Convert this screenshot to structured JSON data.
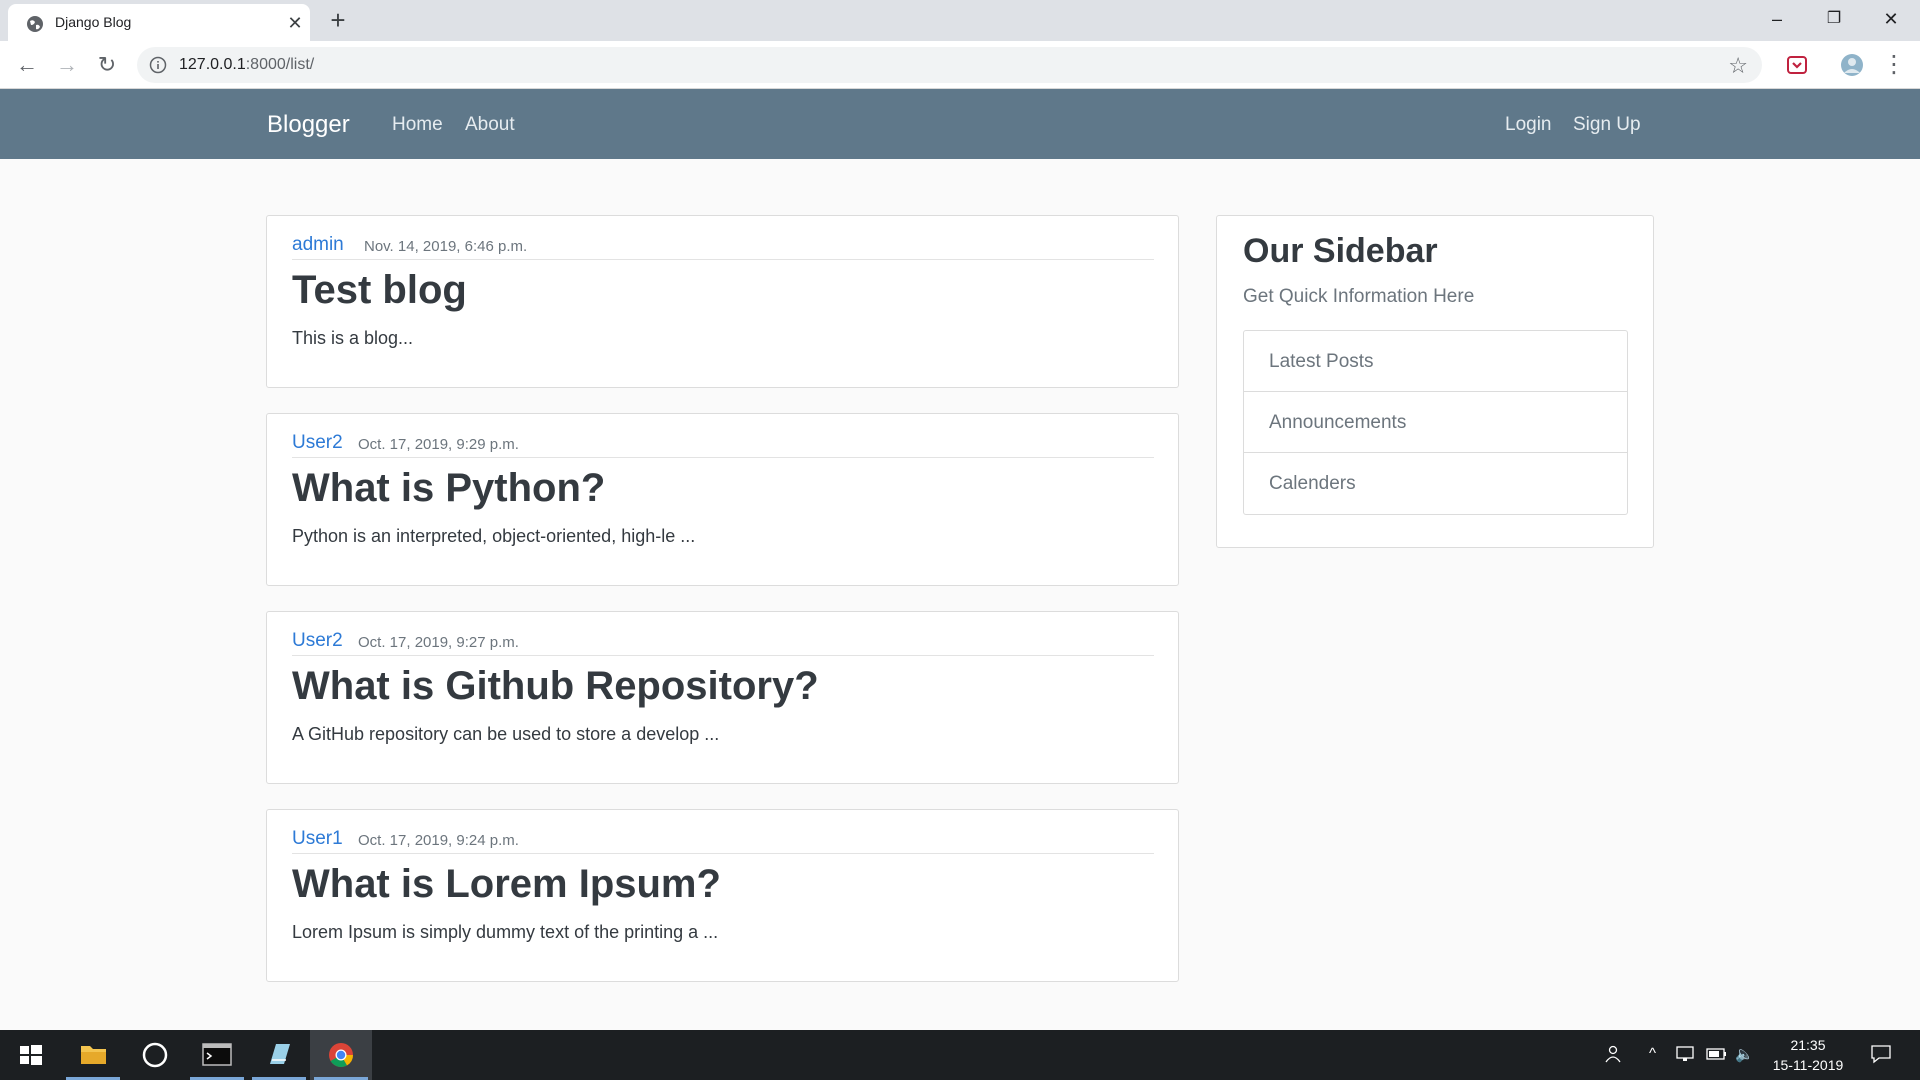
{
  "browser": {
    "tab_title": "Django Blog",
    "tab_close": "✕",
    "new_tab": "+",
    "url_host": "127.0.0.1",
    "url_rest": ":8000/list/",
    "win_minimize": "–",
    "win_restore": "❐",
    "win_close": "✕",
    "back": "←",
    "forward": "→",
    "reload": "↻",
    "bookmark_star": "☆",
    "menu": "⋮"
  },
  "navbar": {
    "brand": "Blogger",
    "links": [
      "Home",
      "About"
    ],
    "right_links": [
      "Login",
      "Sign Up"
    ]
  },
  "posts": [
    {
      "author": "admin",
      "date": "Nov. 14, 2019, 6:46 p.m.",
      "title": "Test blog",
      "excerpt": "This is a blog..."
    },
    {
      "author": "User2",
      "date": "Oct. 17, 2019, 9:29 p.m.",
      "title": "What is Python?",
      "excerpt": "Python is an interpreted, object-oriented, high-le ..."
    },
    {
      "author": "User2",
      "date": "Oct. 17, 2019, 9:27 p.m.",
      "title": "What is Github Repository?",
      "excerpt": "A GitHub repository can be used to store a develop ..."
    },
    {
      "author": "User1",
      "date": "Oct. 17, 2019, 9:24 p.m.",
      "title": "What is Lorem Ipsum?",
      "excerpt": "Lorem Ipsum is simply dummy text of the printing a ..."
    }
  ],
  "sidebar": {
    "title": "Our Sidebar",
    "subtitle": "Get Quick Information Here",
    "items": [
      "Latest Posts",
      "Announcements",
      "Calenders"
    ]
  },
  "taskbar": {
    "time": "21:35",
    "date": "15-11-2019",
    "tray_chevron": "^",
    "tray_volume": "🔈"
  },
  "colors": {
    "navbar": "#5f788a",
    "author_link": "#2d7ad6",
    "page_background": "#fafafa"
  }
}
